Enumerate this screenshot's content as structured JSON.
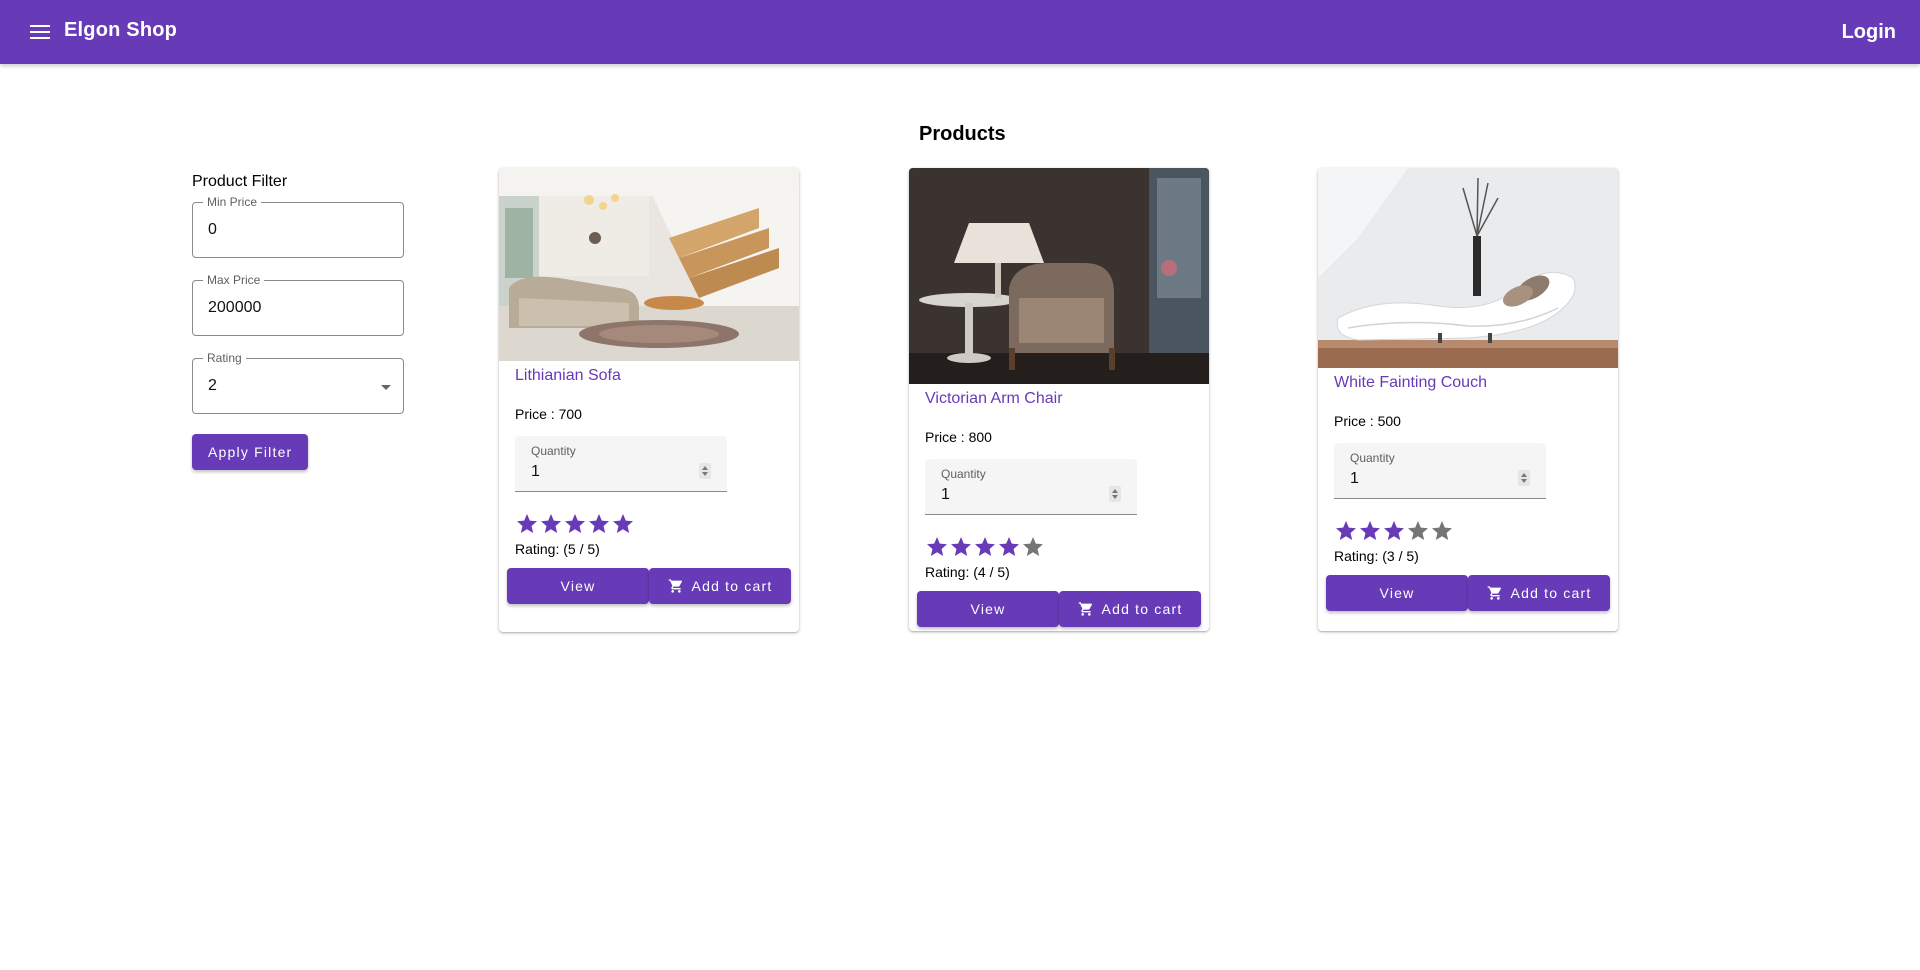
{
  "app": {
    "title": "Elgon Shop",
    "login_label": "Login",
    "accent_color": "#673ab7"
  },
  "icons": {
    "menu": "menu-icon",
    "cart": "shopping-cart-icon",
    "star": "star-icon"
  },
  "filter": {
    "title": "Product Filter",
    "min_price": {
      "label": "Min Price",
      "value": "0"
    },
    "max_price": {
      "label": "Max Price",
      "value": "200000"
    },
    "rating": {
      "label": "Rating",
      "value": "2"
    },
    "apply_label": "Apply Filter"
  },
  "products_heading": "Products",
  "products": [
    {
      "name": "Lithianian Sofa",
      "price_text": "Price : 700",
      "quantity_label": "Quantity",
      "quantity_value": "1",
      "rating": 5,
      "rating_text": "Rating: (5 / 5)",
      "view_label": "View",
      "cart_label": "Add to cart"
    },
    {
      "name": "Victorian Arm Chair",
      "price_text": "Price : 800",
      "quantity_label": "Quantity",
      "quantity_value": "1",
      "rating": 4,
      "rating_text": "Rating: (4 / 5)",
      "view_label": "View",
      "cart_label": "Add to cart"
    },
    {
      "name": "White Fainting Couch",
      "price_text": "Price : 500",
      "quantity_label": "Quantity",
      "quantity_value": "1",
      "rating": 3,
      "rating_text": "Rating: (3 / 5)",
      "view_label": "View",
      "cart_label": "Add to cart"
    }
  ]
}
